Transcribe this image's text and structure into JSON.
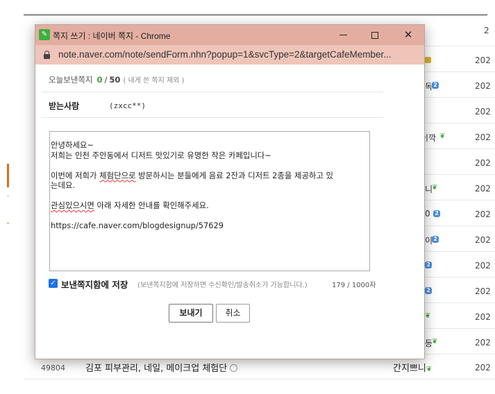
{
  "background": {
    "rows": [
      {
        "author": "",
        "date": "2"
      },
      {
        "author": "",
        "date": "202"
      },
      {
        "author": "독",
        "date": "202"
      },
      {
        "author": "",
        "date": "202"
      },
      {
        "author": "이깍",
        "date": "202"
      },
      {
        "author": "",
        "date": "202"
      },
      {
        "author": "니",
        "date": "202"
      },
      {
        "author": "0",
        "date": "202"
      },
      {
        "author": "이",
        "date": "202"
      },
      {
        "author": "",
        "date": "202"
      },
      {
        "author": "",
        "date": "202"
      },
      {
        "author": "",
        "date": "202"
      },
      {
        "author": "등",
        "date": "202"
      }
    ],
    "bottom_row": {
      "number": "49804",
      "title": "김포 피부관리, 네일, 메이크업 체험단",
      "author": "간지쁘니",
      "date": "202"
    }
  },
  "window": {
    "title": "쪽지 쓰기 : 네이버 쪽지 - Chrome",
    "url": "note.naver.com/note/sendForm.nhn?popup=1&svcType=2&targetCafeMember...",
    "titlebar_color": "#e3aea1",
    "urlbar_color": "#efc4b9"
  },
  "form": {
    "sent_label": "오늘보낸쪽지",
    "sent_count": "0",
    "sent_max": "50",
    "sent_note": "( 내게 쓴 쪽지 제외 )",
    "recipient_label": "받는사람",
    "recipient_value": "(zxcc**)",
    "message_lines": [
      "안녕하세요~",
      "저희는 인천 주안동에서 디저트 맛있기로 유명한 작은 카페입니다~",
      "",
      "이번에 저희가 체험단으로 방문하시는 분들에게 음료 2잔과 디저트 2종을 제공하고 있",
      "는데요.",
      "",
      "관심있으시면 아래 자세한 안내를 확인해주세요.",
      "",
      "https://cafe.naver.com/blogdesignup/57629"
    ],
    "save_label": "보낸쪽지함에 저장",
    "save_checked": true,
    "save_note": "(보낸쪽지함에 저장하면 수신확인/발송취소가 가능합니다.)",
    "char_count": "179 / 1000자",
    "send_button": "보내기",
    "cancel_button": "취소",
    "accent_color": "#3aa53a",
    "checkbox_color": "#1a73e8"
  }
}
